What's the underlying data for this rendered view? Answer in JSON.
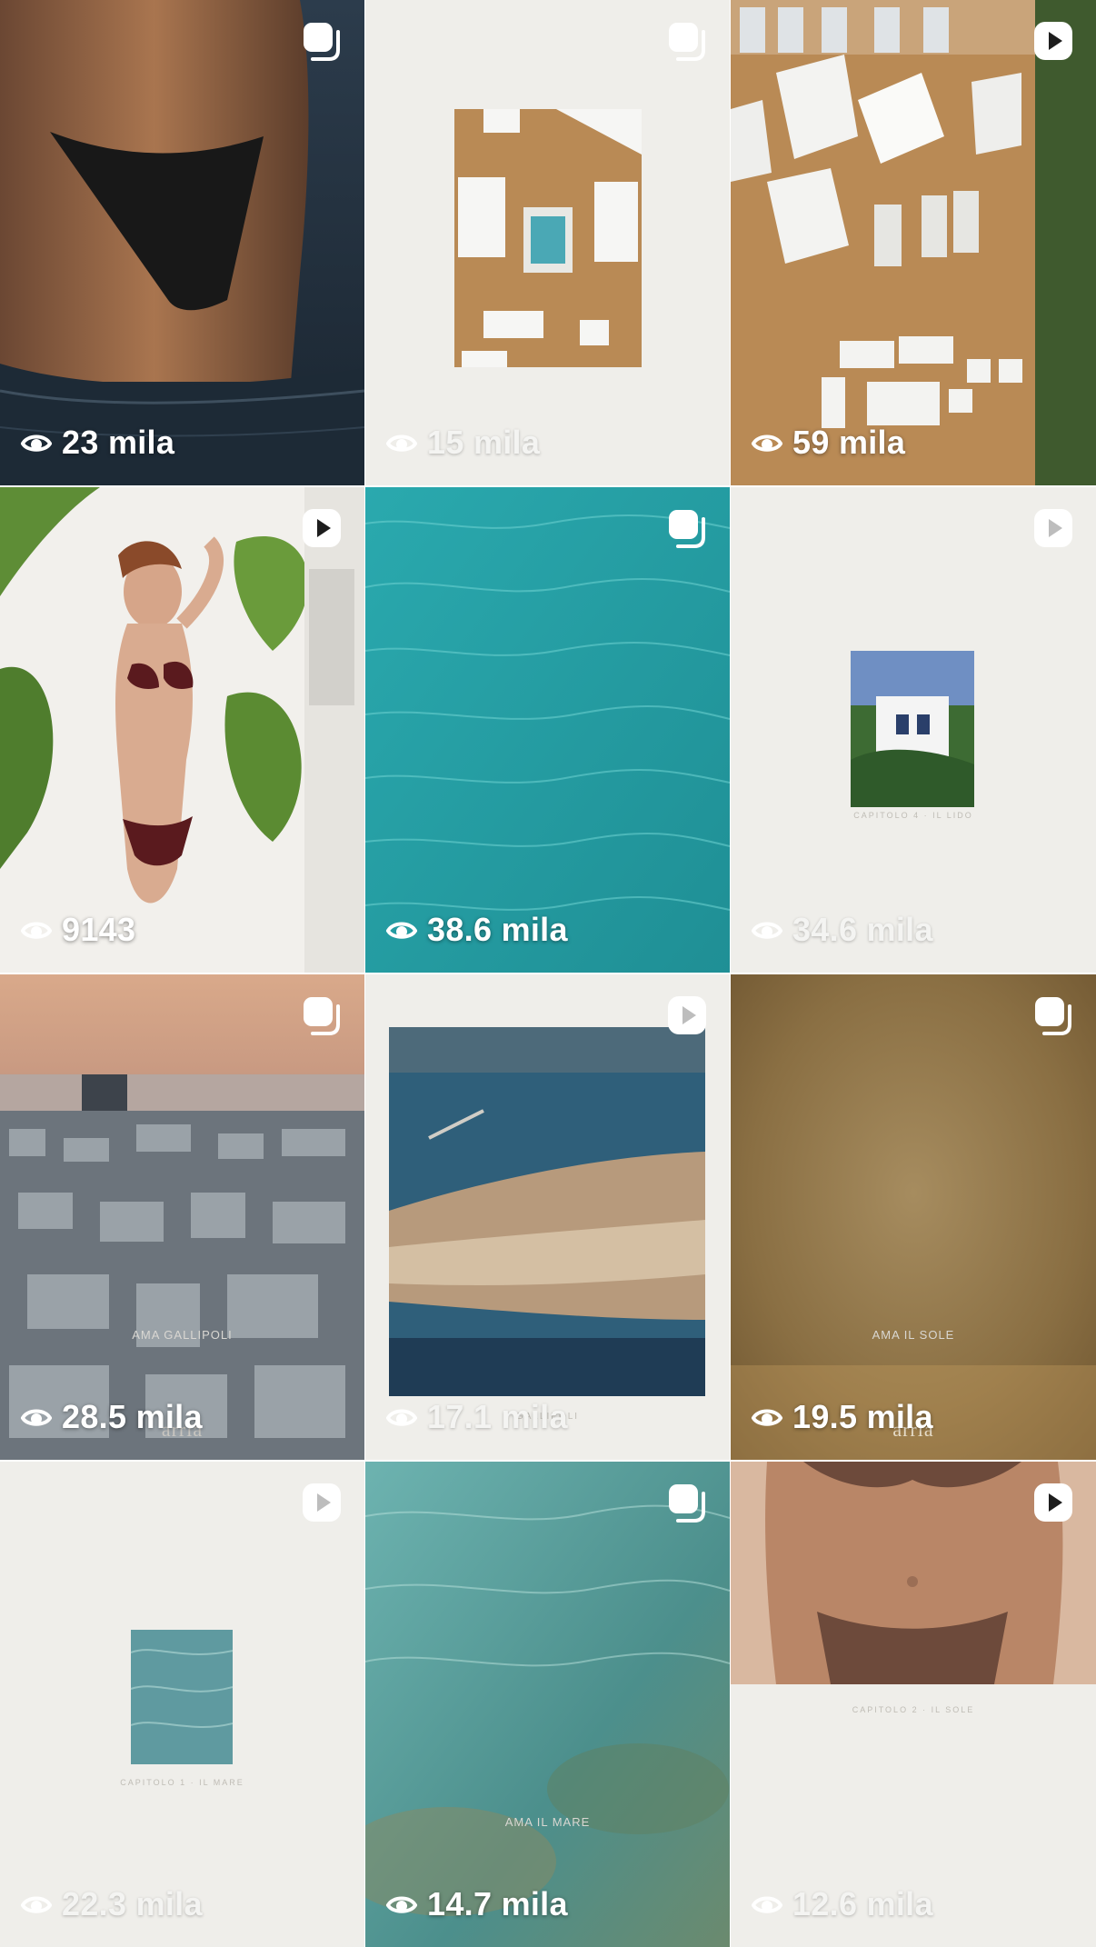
{
  "grid": {
    "tiles": [
      {
        "views": "23 mila",
        "type": "carousel"
      },
      {
        "views": "15 mila",
        "type": "carousel"
      },
      {
        "views": "59 mila",
        "type": "reel"
      },
      {
        "views": "9143",
        "type": "reel"
      },
      {
        "views": "38.6 mila",
        "type": "carousel"
      },
      {
        "views": "34.6 mila",
        "type": "reel",
        "caption": "CAPITOLO 4 · IL LIDO"
      },
      {
        "views": "28.5 mila",
        "type": "carousel",
        "caption": "AMA GALLIPOLI",
        "watermark": "arria"
      },
      {
        "views": "17.1 mila",
        "type": "reel",
        "caption": "GALLIPOLI"
      },
      {
        "views": "19.5 mila",
        "type": "carousel",
        "caption": "AMA IL SOLE",
        "watermark": "arria"
      },
      {
        "views": "22.3 mila",
        "type": "reel",
        "caption": "CAPITOLO 1 · IL MARE"
      },
      {
        "views": "14.7 mila",
        "type": "carousel",
        "caption": "AMA IL MARE"
      },
      {
        "views": "12.6 mila",
        "type": "reel",
        "caption": "CAPITOLO 2 · IL SOLE"
      }
    ]
  },
  "colors": {
    "badge": "#ffffff",
    "views_text": "#ffffff",
    "sea_turquoise": "#2fb3b8",
    "deck_wood": "#b98a55",
    "paper": "#efeeea"
  },
  "icons": {
    "views": "eye-icon",
    "carousel": "carousel-icon",
    "reel": "reel-play-icon"
  }
}
